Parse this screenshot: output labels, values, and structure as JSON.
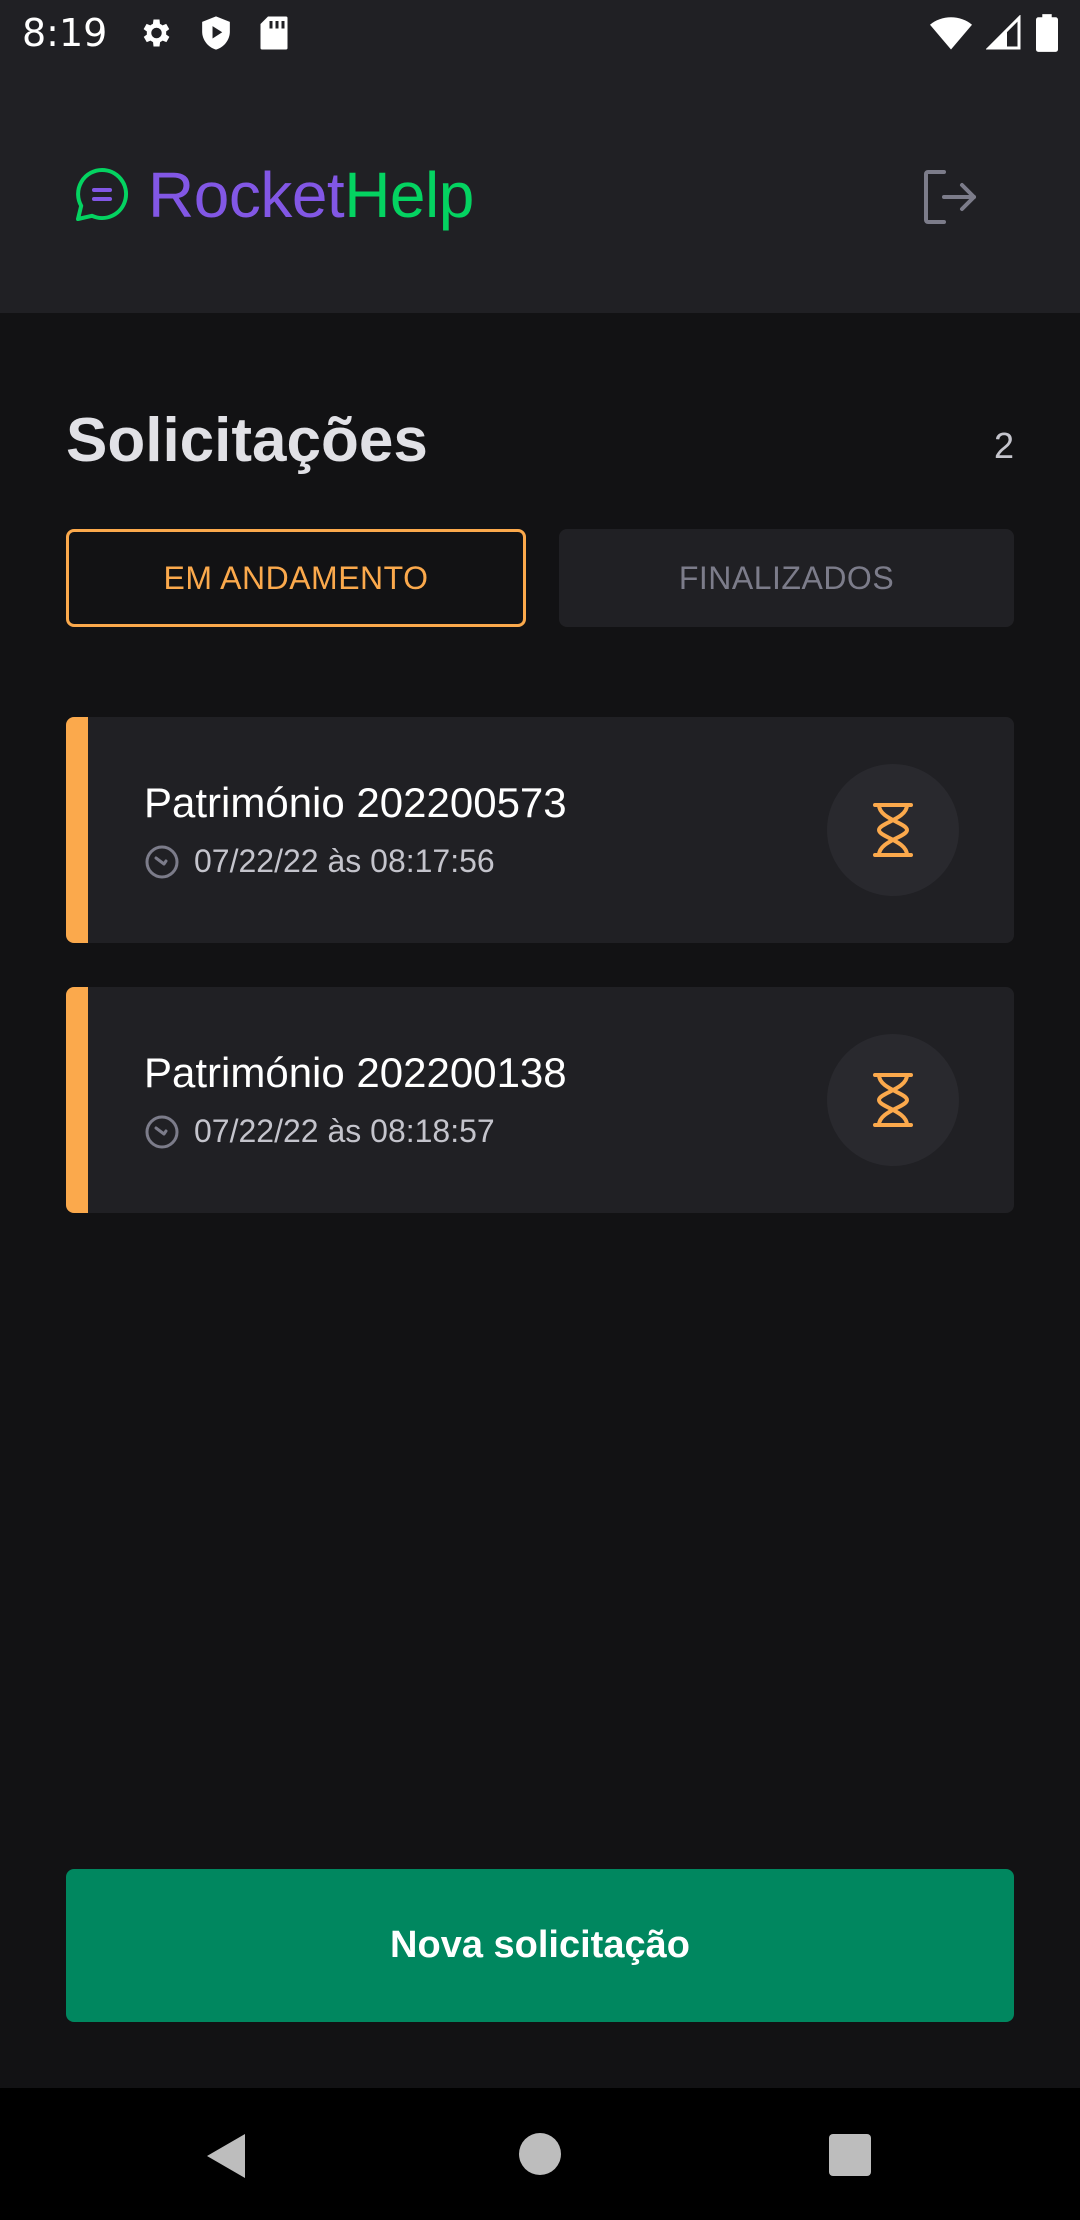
{
  "status_bar": {
    "time": "8:19",
    "icons": [
      "settings-icon",
      "shield-play-icon",
      "sd-card-icon",
      "wifi-icon",
      "signal-icon",
      "battery-icon"
    ]
  },
  "header": {
    "logo_part1": "Rocket",
    "logo_part2": "Help",
    "logout_icon": "sign-out-icon"
  },
  "main": {
    "title": "Solicitações",
    "count": "2",
    "filters": [
      {
        "label": "EM ANDAMENTO",
        "active": true
      },
      {
        "label": "FINALIZADOS",
        "active": false
      }
    ],
    "orders": [
      {
        "title": "Património 202200573",
        "date": "07/22/22 às 08:17:56",
        "status": "open",
        "status_icon": "hourglass-icon"
      },
      {
        "title": "Património 202200138",
        "date": "07/22/22 às 08:18:57",
        "status": "open",
        "status_icon": "hourglass-icon"
      }
    ],
    "new_button": "Nova solicitação"
  },
  "colors": {
    "brand_purple": "#8257E5",
    "brand_green": "#04D361",
    "accent_orange": "#FBA94C",
    "button_green": "#00875F",
    "background": "#121214",
    "surface": "#202024"
  },
  "nav": {
    "icons": [
      "back-icon",
      "home-icon",
      "recents-icon"
    ]
  }
}
